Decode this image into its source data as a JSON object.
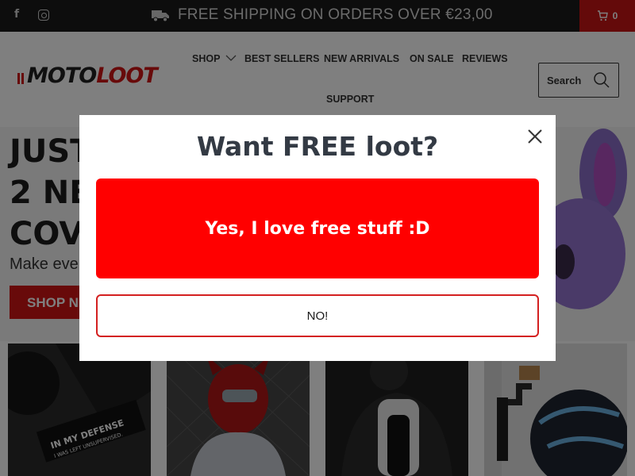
{
  "topbar": {
    "social": [
      {
        "icon": "facebook-icon",
        "glyph": "f"
      },
      {
        "icon": "instagram-icon"
      }
    ],
    "shipping_icon": "truck-icon",
    "shipping_text": "FREE SHIPPING ON ORDERS OVER €23,00",
    "cart_icon": "cart-icon",
    "cart_count": "0"
  },
  "header": {
    "logo_part1": "MOTO",
    "logo_part2": "LOOT",
    "nav": [
      {
        "label": "SHOP"
      },
      {
        "label": "BEST SELLERS"
      },
      {
        "label": "NEW ARRIVALS"
      },
      {
        "label": "ON SALE"
      },
      {
        "label": "REVIEWS"
      },
      {
        "label": "SUPPORT"
      }
    ],
    "search_label": "Search",
    "search_icon": "search-icon"
  },
  "hero": {
    "lines": [
      "JUST",
      "2 NE",
      "COV"
    ],
    "subtitle": "Make eve",
    "button": "SHOP N"
  },
  "tiles": {
    "keychain_line1": "IN MY DEFENSE",
    "keychain_line2": "I WAS LEFT UNSUPERVISED."
  },
  "modal": {
    "title": "Want FREE loot?",
    "yes_label": "Yes, I love free stuff :D",
    "no_label": "NO!",
    "close_icon": "close-icon"
  },
  "colors": {
    "accent_red": "#ff0000",
    "brand_red": "#d11414",
    "topbar_bg": "#1a1a1a"
  }
}
